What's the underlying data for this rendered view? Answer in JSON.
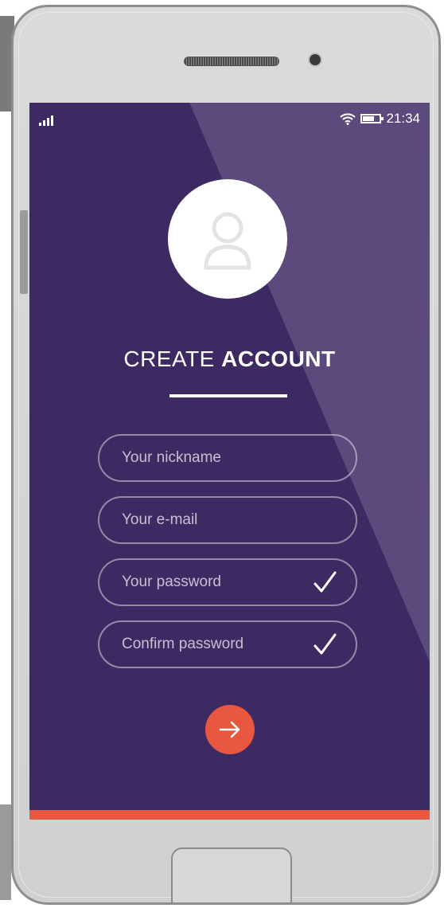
{
  "status_bar": {
    "time": "21:34"
  },
  "screen": {
    "title_light": "CREATE",
    "title_bold": "ACCOUNT",
    "fields": [
      {
        "placeholder": "Your nickname"
      },
      {
        "placeholder": "Your e-mail"
      },
      {
        "placeholder": "Your password",
        "validated": true
      },
      {
        "placeholder": "Confirm password",
        "validated": true
      }
    ]
  },
  "icons": {
    "avatar": "user-silhouette-icon",
    "check": "checkmark-icon",
    "submit": "arrow-right-icon"
  },
  "colors": {
    "background": "#3d2a62",
    "accent": "#e8573f"
  }
}
